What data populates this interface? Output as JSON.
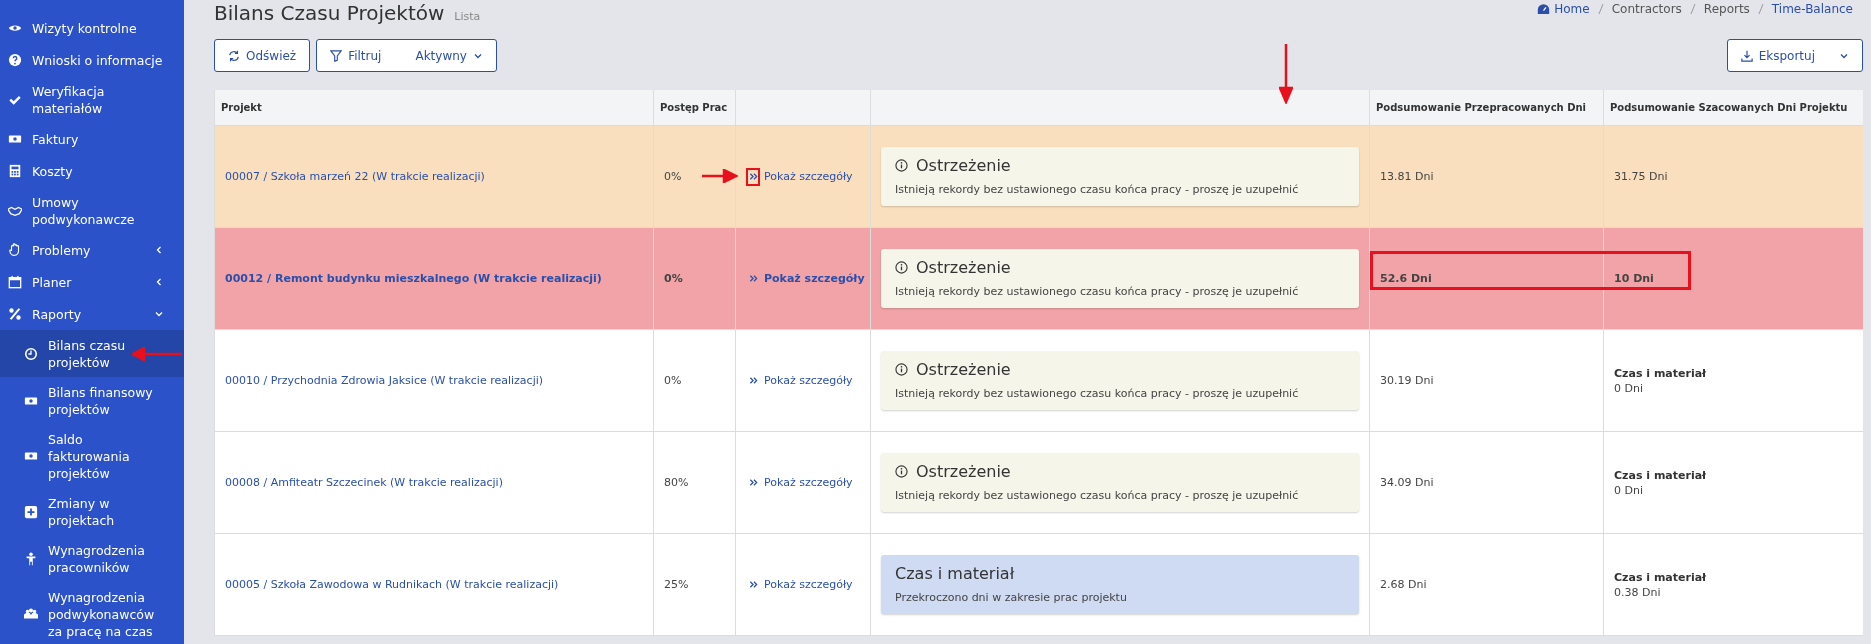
{
  "sidebar": {
    "items": [
      {
        "label": "Wizyty kontrolne",
        "selected": false
      },
      {
        "label": "Wnioski o informacje",
        "selected": false
      },
      {
        "label": "Weryfikacja materiałów",
        "selected": false
      },
      {
        "label": "Faktury",
        "selected": false
      },
      {
        "label": "Koszty",
        "selected": false
      },
      {
        "label": "Umowy podwykonawcze",
        "selected": false
      },
      {
        "label": "Problemy",
        "selected": false,
        "expanded": false
      },
      {
        "label": "Planer",
        "selected": false,
        "expanded": false
      },
      {
        "label": "Raporty",
        "selected": false,
        "expanded": true,
        "children": [
          {
            "label": "Bilans czasu projektów",
            "selected": true
          },
          {
            "label": "Bilans finansowy projektów",
            "selected": false
          },
          {
            "label": "Saldo fakturowania projektów",
            "selected": false
          },
          {
            "label": "Zmiany w projektach",
            "selected": false
          },
          {
            "label": "Wynagrodzenia pracowników",
            "selected": false
          },
          {
            "label": "Wynagrodzenia podwykonawców za pracę na czas",
            "selected": false
          }
        ]
      }
    ]
  },
  "page": {
    "title": "Bilans Czasu Projektów",
    "subtitle": "Lista"
  },
  "breadcrumb": [
    {
      "label": "Home",
      "link": true
    },
    {
      "label": "Contractors",
      "link": false
    },
    {
      "label": "Reports",
      "link": false
    },
    {
      "label": "Time-Balance",
      "link": true
    }
  ],
  "toolbar": {
    "refresh": "Odśwież",
    "filter": "Filtruj",
    "filter_value": "Aktywny",
    "export": "Eksportuj"
  },
  "table": {
    "columns": [
      "Projekt",
      "Postęp Prac",
      "",
      "",
      "Podsumowanie Przepracowanych Dni",
      "Podsumowanie Szacowanych Dni Projektu"
    ],
    "rows": [
      {
        "kind": "warning",
        "project": "00007 / Szkoła marzeń 22 (W trakcie realizacji)",
        "progress": "0%",
        "link": "Pokaż szczegóły",
        "notice": {
          "kind": "warning",
          "title": "Ostrzeżenie",
          "text": "Istnieją rekordy bez ustawionego czasu końca pracy - proszę je uzupełnić"
        },
        "worked": "13.81 Dni",
        "estimate": {
          "days": "31.75 Dni"
        }
      },
      {
        "kind": "danger",
        "project": "00012 / Remont budynku mieszkalnego (W trakcie realizacji)",
        "progress": "0%",
        "link": "Pokaż szczegóły",
        "notice": {
          "kind": "warning",
          "title": "Ostrzeżenie",
          "text": "Istnieją rekordy bez ustawionego czasu końca pracy - proszę je uzupełnić"
        },
        "worked": "52.6 Dni",
        "estimate": {
          "days": "10 Dni"
        }
      },
      {
        "kind": "normal",
        "project": "00010 / Przychodnia Zdrowia Jaksice (W trakcie realizacji)",
        "progress": "0%",
        "link": "Pokaż szczegóły",
        "notice": {
          "kind": "warning",
          "title": "Ostrzeżenie",
          "text": "Istnieją rekordy bez ustawionego czasu końca pracy - proszę je uzupełnić"
        },
        "worked": "30.19 Dni",
        "estimate": {
          "label": "Czas i materiał",
          "days": "0 Dni"
        }
      },
      {
        "kind": "normal",
        "project": "00008 / Amfiteatr Szczecinek (W trakcie realizacji)",
        "progress": "80%",
        "link": "Pokaż szczegóły",
        "notice": {
          "kind": "warning",
          "title": "Ostrzeżenie",
          "text": "Istnieją rekordy bez ustawionego czasu końca pracy - proszę je uzupełnić"
        },
        "worked": "34.09 Dni",
        "estimate": {
          "label": "Czas i materiał",
          "days": "0 Dni"
        }
      },
      {
        "kind": "normal",
        "project": "00005 / Szkoła Zawodowa w Rudnikach (W trakcie realizacji)",
        "progress": "25%",
        "link": "Pokaż szczegóły",
        "notice": {
          "kind": "info",
          "title": "Czas i materiał",
          "text": "Przekroczono dni w zakresie prac projektu"
        },
        "worked": "2.68 Dni",
        "estimate": {
          "label": "Czas i materiał",
          "days": "0.38 Dni"
        }
      }
    ]
  }
}
